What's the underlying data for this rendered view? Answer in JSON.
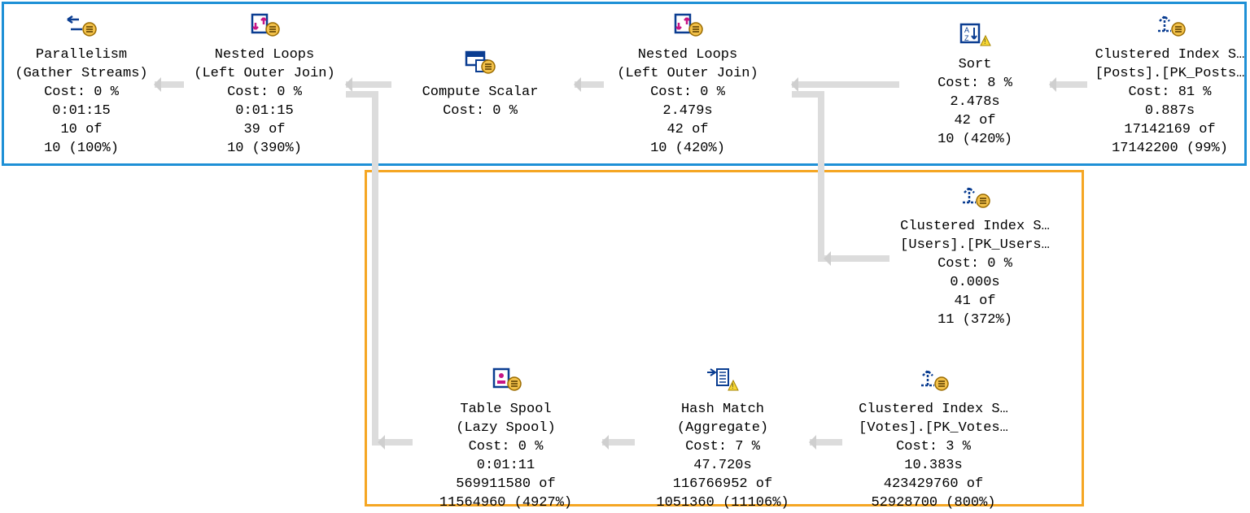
{
  "nodes": {
    "parallelism": {
      "line1": "Parallelism",
      "line2": "(Gather Streams)",
      "line3": "Cost: 0 %",
      "line4": "0:01:15",
      "line5": "10 of",
      "line6": "10 (100%)"
    },
    "nestedloops1": {
      "line1": "Nested Loops",
      "line2": "(Left Outer Join)",
      "line3": "Cost: 0 %",
      "line4": "0:01:15",
      "line5": "39 of",
      "line6": "10 (390%)"
    },
    "computescalar": {
      "line1": "Compute Scalar",
      "line2": "Cost: 0 %"
    },
    "nestedloops2": {
      "line1": "Nested Loops",
      "line2": "(Left Outer Join)",
      "line3": "Cost: 0 %",
      "line4": "2.479s",
      "line5": "42 of",
      "line6": "10 (420%)"
    },
    "sort": {
      "line1": "Sort",
      "line2": "Cost: 8 %",
      "line3": "2.478s",
      "line4": "42 of",
      "line5": "10 (420%)"
    },
    "cis_posts": {
      "line1": "Clustered Index S…",
      "line2": "[Posts].[PK_Posts…",
      "line3": "Cost: 81 %",
      "line4": "0.887s",
      "line5": "17142169 of",
      "line6": "17142200 (99%)"
    },
    "cis_users": {
      "line1": "Clustered Index S…",
      "line2": "[Users].[PK_Users…",
      "line3": "Cost: 0 %",
      "line4": "0.000s",
      "line5": "41 of",
      "line6": "11 (372%)"
    },
    "tablespool": {
      "line1": "Table Spool",
      "line2": "(Lazy Spool)",
      "line3": "Cost: 0 %",
      "line4": "0:01:11",
      "line5": "569911580 of",
      "line6": "11564960 (4927%)"
    },
    "hashmatch": {
      "line1": "Hash Match",
      "line2": "(Aggregate)",
      "line3": "Cost: 7 %",
      "line4": "47.720s",
      "line5": "116766952 of",
      "line6": "1051360 (11106%)"
    },
    "cis_votes": {
      "line1": "Clustered Index S…",
      "line2": "[Votes].[PK_Votes…",
      "line3": "Cost: 3 %",
      "line4": "10.383s",
      "line5": "423429760 of",
      "line6": "52928700 (800%)"
    }
  }
}
